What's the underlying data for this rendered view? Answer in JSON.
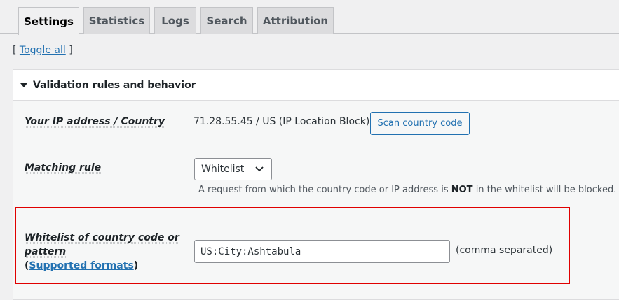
{
  "tabs": [
    {
      "label": "Settings",
      "active": true
    },
    {
      "label": "Statistics",
      "active": false
    },
    {
      "label": "Logs",
      "active": false
    },
    {
      "label": "Search",
      "active": false
    },
    {
      "label": "Attribution",
      "active": false
    }
  ],
  "toggle": {
    "open": "[",
    "link": "Toggle all",
    "close": "]"
  },
  "section": {
    "title": "Validation rules and behavior",
    "ip_row": {
      "label": "Your IP address / Country",
      "value": "71.28.55.45 / US (IP Location Block)",
      "button": "Scan country code"
    },
    "matching_rule": {
      "label": "Matching rule",
      "selected": "Whitelist",
      "desc_before": "A request from which the country code or IP address is",
      "desc_strong": "NOT",
      "desc_after": "in the whitelist will be blocked."
    },
    "whitelist": {
      "label": "Whitelist of country code or pattern",
      "link_open": "(",
      "link": "Supported formats",
      "link_close": ")",
      "value": "US:City:Ashtabula",
      "suffix": "(comma separated)"
    }
  },
  "colors": {
    "highlight": "#e00000",
    "link": "#2271b1"
  }
}
